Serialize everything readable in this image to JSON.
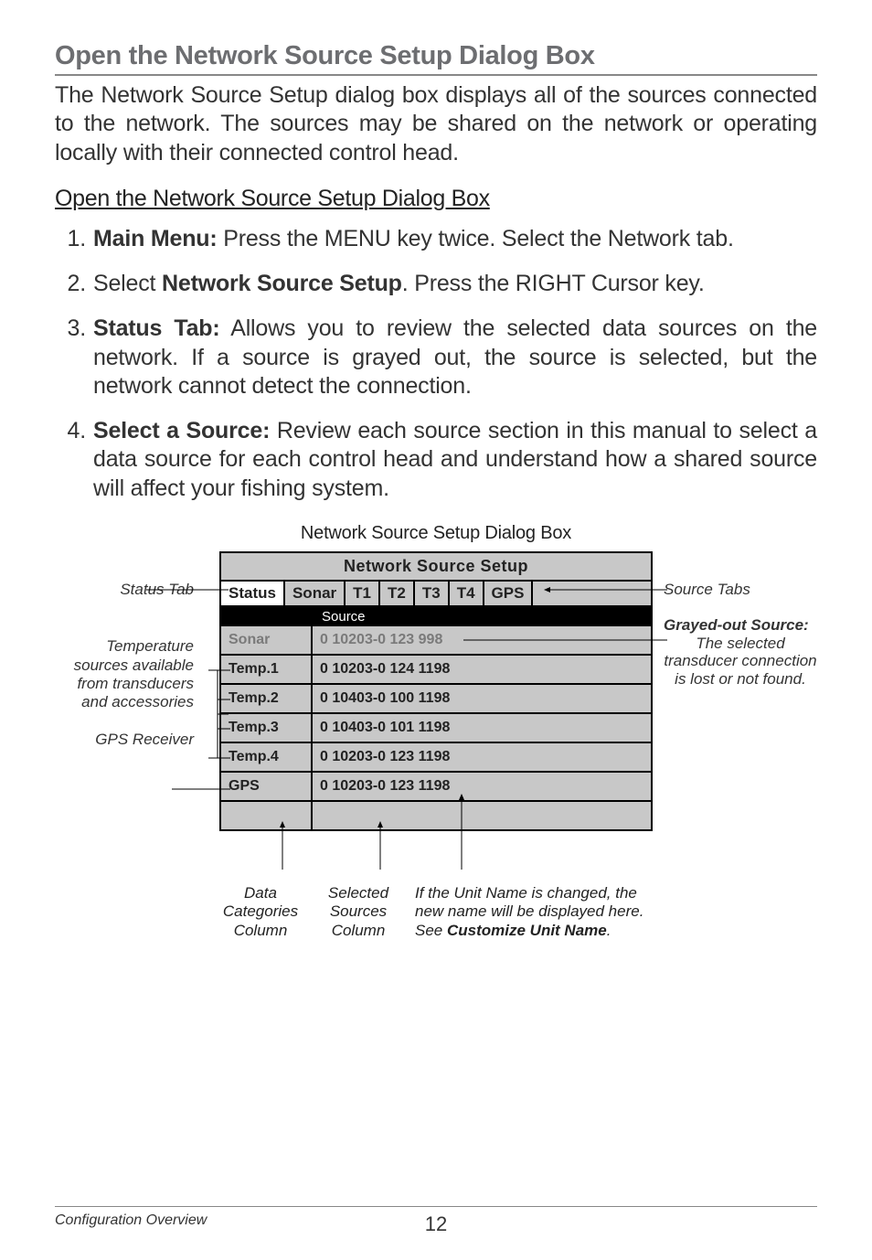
{
  "heading": "Open the Network Source Setup Dialog Box",
  "intro": "The Network Source Setup dialog box displays all of the sources connected to the network. The sources may be shared on the network or operating locally with their connected control head.",
  "subheading": "Open the Network Source Setup Dialog Box",
  "steps": [
    {
      "bold": "Main Menu:",
      "rest": " Press the MENU key twice. Select the Network tab."
    },
    {
      "pre": "Select ",
      "bold": "Network Source Setup",
      "rest": ". Press the RIGHT Cursor key."
    },
    {
      "bold": "Status Tab:",
      "rest": " Allows you to review the selected data sources on the network. If a source is grayed out, the source is selected, but the network cannot detect the connection."
    },
    {
      "bold": "Select a Source:",
      "rest": " Review each source section in this manual to select a data source for each control head and understand how a shared source will affect your fishing system."
    }
  ],
  "figure_title": "Network Source Setup Dialog Box",
  "dialog": {
    "title": "Network Source Setup",
    "tabs": [
      "Status",
      "Sonar",
      "T1",
      "T2",
      "T3",
      "T4",
      "GPS"
    ],
    "active_tab_index": 0,
    "source_header": "Source",
    "rows": [
      {
        "category": "Sonar",
        "value": "0 10203-0 123  998",
        "grayed": true
      },
      {
        "category": "Temp.1",
        "value": "0 10203-0 124 1198",
        "grayed": false
      },
      {
        "category": "Temp.2",
        "value": "0 10403-0 100 1198",
        "grayed": false
      },
      {
        "category": "Temp.3",
        "value": "0 10403-0 101 1198",
        "grayed": false
      },
      {
        "category": "Temp.4",
        "value": "0 10203-0 123 1198",
        "grayed": false
      },
      {
        "category": "GPS",
        "value": "0 10203-0 123 1198",
        "grayed": false
      }
    ]
  },
  "left_callouts": {
    "status_tab": "Status Tab",
    "temp_sources": "Temperature sources available from transducers and accessories",
    "gps_receiver": "GPS Receiver"
  },
  "right_callouts": {
    "source_tabs": "Source Tabs",
    "grayed_out_title": "Grayed-out Source:",
    "grayed_out_body": "The selected transducer connection is lost or not found."
  },
  "bottom_callouts": {
    "col1": "Data Categories Column",
    "col2": "Selected Sources Column",
    "col3_line1": "If the Unit Name is changed, the",
    "col3_line2": "new name will be displayed here.",
    "col3_line3_pre": "See ",
    "col3_line3_bold": "Customize Unit Name",
    "col3_line3_post": "."
  },
  "footer": {
    "section": "Configuration Overview",
    "page": "12"
  }
}
